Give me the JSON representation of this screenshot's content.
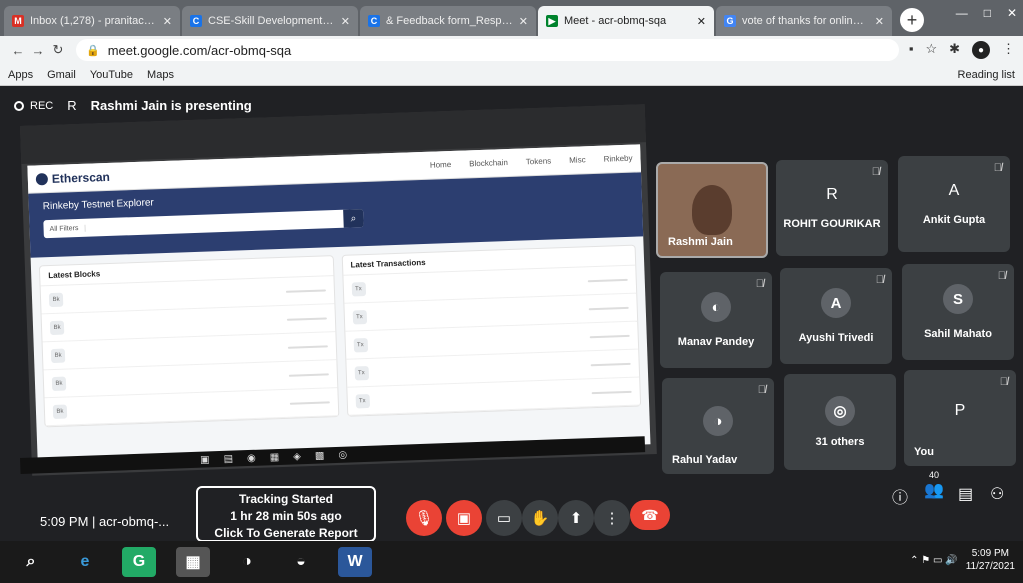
{
  "tabs": [
    "Inbox (1,278) - pranitachaudha",
    "CSE-Skill Development worksh",
    "& Feedback form_Responce Sh",
    "Meet - acr-obmq-sqa",
    "vote of thanks for online webin"
  ],
  "url": "meet.google.com/acr-obmq-sqa",
  "bookmarks": [
    "Apps",
    "Gmail",
    "YouTube",
    "Maps",
    "Reading list"
  ],
  "meet": {
    "rec_label": "REC",
    "presenter_initial": "R",
    "presenting_text": "Rashmi Jain is presenting",
    "time": "5:09 PM",
    "code": "acr-obmq-...",
    "people_count": "40"
  },
  "etherscan": {
    "logo": "Etherscan",
    "nav": [
      "Home",
      "Blockchain",
      "Tokens",
      "Misc",
      "Rinkeby"
    ],
    "explorer_title": "Rinkeby Testnet Explorer",
    "filter": "All Filters",
    "search_placeholder": "",
    "blocks_title": "Latest Blocks",
    "tx_title": "Latest Transactions"
  },
  "participants": [
    {
      "name": "Rashmi Jain"
    },
    {
      "initial": "R",
      "name": "ROHIT GOURIKAR"
    },
    {
      "initial": "A",
      "name": "Ankit Gupta"
    },
    {
      "name": "Manav Pandey"
    },
    {
      "initial": "A",
      "name": "Ayushi Trivedi"
    },
    {
      "initial": "S",
      "name": "Sahil Mahato"
    },
    {
      "name": "Rahul Yadav"
    },
    {
      "name": "31 others"
    },
    {
      "initial": "P",
      "name": "You"
    }
  ],
  "tracking": {
    "line1": "Tracking Started",
    "line2": "1 hr 28 min 50s ago",
    "line3": "Click To Generate Report"
  },
  "taskbar": {
    "time": "5:09 PM",
    "date": "11/27/2021"
  }
}
